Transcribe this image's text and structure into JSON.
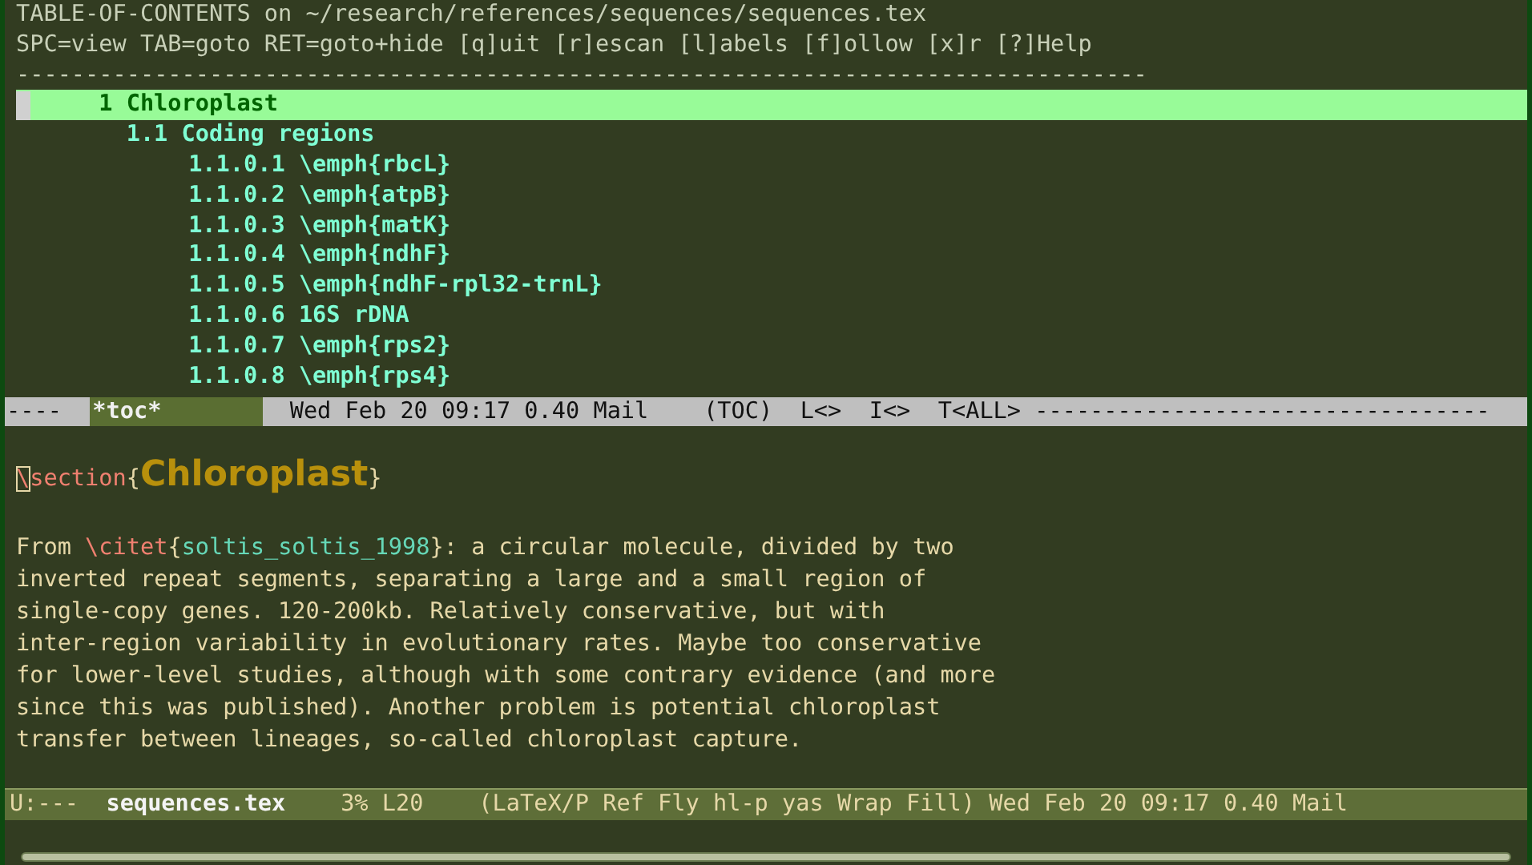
{
  "toc_window": {
    "header_lines": [
      "TABLE-OF-CONTENTS on ~/research/references/sequences/sequences.tex",
      "SPC=view TAB=goto RET=goto+hide [q]uit [r]escan [l]abels [f]ollow [x]r [?]Help"
    ],
    "separator": "----------------------------------------------------------------------------------",
    "entries": [
      {
        "number": "1",
        "title": "Chloroplast",
        "selected": true,
        "children": [
          {
            "number": "1.1",
            "title": "Coding regions",
            "selected": false,
            "children": [
              {
                "number": "1.1.0.1",
                "title": "\\emph{rbcL}",
                "selected": false
              },
              {
                "number": "1.1.0.2",
                "title": "\\emph{atpB}",
                "selected": false
              },
              {
                "number": "1.1.0.3",
                "title": "\\emph{matK}",
                "selected": false
              },
              {
                "number": "1.1.0.4",
                "title": "\\emph{ndhF}",
                "selected": false
              },
              {
                "number": "1.1.0.5",
                "title": "\\emph{ndhF-rpl32-trnL}",
                "selected": false
              },
              {
                "number": "1.1.0.6",
                "title": "16S rDNA",
                "selected": false
              },
              {
                "number": "1.1.0.7",
                "title": "\\emph{rps2}",
                "selected": false
              },
              {
                "number": "1.1.0.8",
                "title": "\\emph{rps4}",
                "selected": false
              }
            ]
          }
        ]
      }
    ]
  },
  "toc_mode_line": {
    "flags": "----",
    "buffer": "*toc*",
    "info": "Wed Feb 20 09:17 0.40 Mail",
    "mode": "(TOC)",
    "fields": [
      "L<>",
      "I<>",
      "T<ALL>"
    ],
    "fill": "---------------------------------"
  },
  "editor": {
    "section_command": "\\section",
    "open_brace": "{",
    "section_title": "Chloroplast",
    "close_brace": "}",
    "lines": [
      [
        {
          "kind": "text",
          "text": "From "
        },
        {
          "kind": "command",
          "text": "\\citet"
        },
        {
          "kind": "text",
          "text": "{"
        },
        {
          "kind": "key",
          "text": "soltis_soltis_1998"
        },
        {
          "kind": "text",
          "text": "}: a circular molecule, divided by two"
        }
      ],
      [
        {
          "kind": "text",
          "text": "inverted repeat segments, separating a large and a small region of"
        }
      ],
      [
        {
          "kind": "text",
          "text": "single-copy genes. 120-200kb. Relatively conservative, but with"
        }
      ],
      [
        {
          "kind": "text",
          "text": "inter-region variability in evolutionary rates. Maybe too conservative"
        }
      ],
      [
        {
          "kind": "text",
          "text": "for lower-level studies, although with some contrary evidence (and more"
        }
      ],
      [
        {
          "kind": "text",
          "text": "since this was published). Another problem is potential chloroplast"
        }
      ],
      [
        {
          "kind": "text",
          "text": "transfer between lineages, so-called chloroplast capture."
        }
      ]
    ]
  },
  "editor_mode_line": {
    "flags": "U:---",
    "buffer": "sequences.tex",
    "position": "3% L20",
    "modes": "(LaTeX/P Ref Fly hl-p yas Wrap Fill) Wed Feb 20 09:17 0.40 Mail"
  }
}
